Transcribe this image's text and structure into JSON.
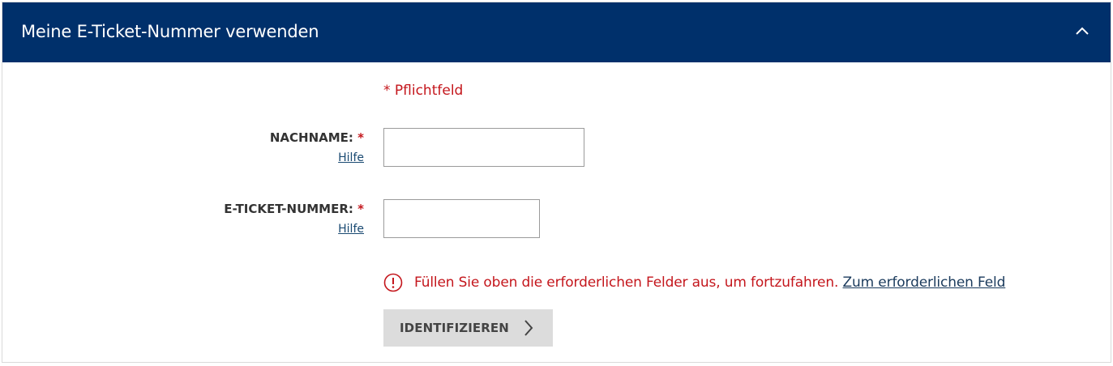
{
  "section": {
    "title": "Meine E-Ticket-Nummer verwenden",
    "toggle_icon": "chevron-up-icon"
  },
  "form": {
    "required_note": "* Pflichtfeld",
    "last_name": {
      "label": "NACHNAME:",
      "required_mark": "*",
      "help": "Hilfe",
      "value": ""
    },
    "ticket_number": {
      "label": "E-TICKET-NUMMER:",
      "required_mark": "*",
      "help": "Hilfe",
      "value": ""
    },
    "error": {
      "icon": "alert-circle-icon",
      "message": "Füllen Sie oben die erforderlichen Felder aus, um fortzufahren.",
      "link": "Zum erforderlichen Feld"
    },
    "submit": {
      "label": "IDENTIFIZIEREN",
      "icon": "chevron-right-icon"
    }
  },
  "colors": {
    "header_bg": "#00306b",
    "error_red": "#c4161c",
    "button_bg": "#dcdcdc"
  }
}
